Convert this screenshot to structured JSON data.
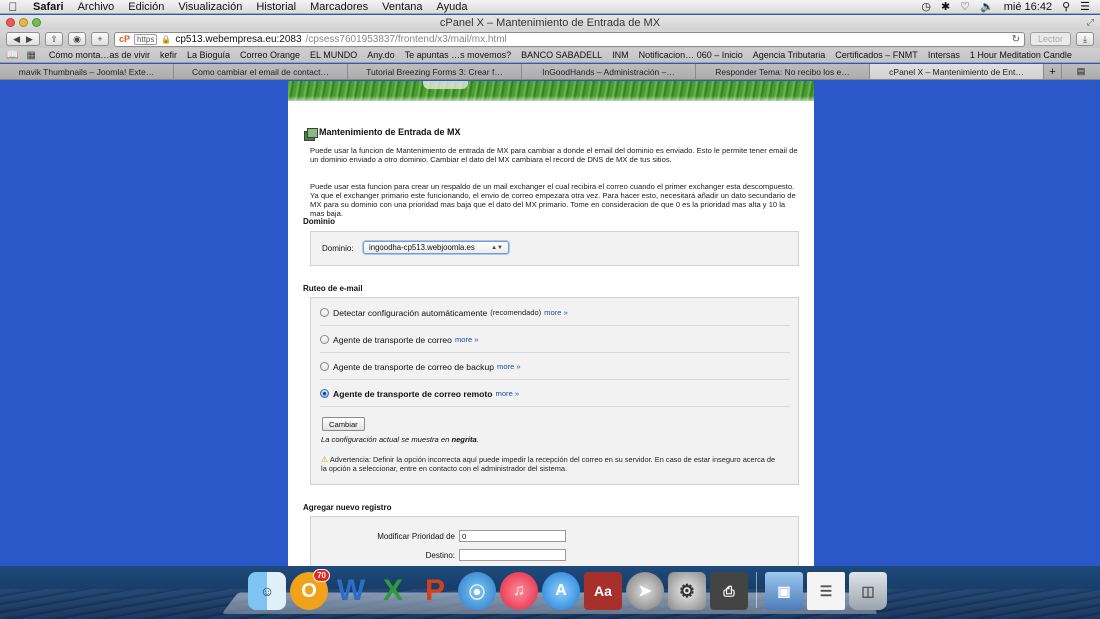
{
  "menubar": {
    "app": "Safari",
    "items": [
      "Archivo",
      "Edición",
      "Visualización",
      "Historial",
      "Marcadores",
      "Ventana",
      "Ayuda"
    ],
    "clock": "mié 16:42"
  },
  "window": {
    "title": "cPanel X – Mantenimiento de Entrada de MX"
  },
  "toolbar": {
    "url_scheme": "https",
    "url_host": "cp513.webempresa.eu:2083",
    "url_path": "/cpsess7601953837/frontend/x3/mail/mx.html",
    "reader_label": "Lector"
  },
  "bookmarks": [
    "Cómo monta…as de vivir",
    "kefir",
    "La Bioguía",
    "Correo Orange",
    "EL MUNDO",
    "Any.do",
    "Te apuntas …s movemos?",
    "BANCO SABADELL",
    "INM",
    "Notificacion… 060 – Inicio",
    "Agencia Tributaria",
    "Certificados – FNMT",
    "Intersas",
    "1 Hour Meditation Candle"
  ],
  "tabs": [
    {
      "label": "mavik Thumbnails – Joomla! Exte…",
      "active": false
    },
    {
      "label": "Como cambiar el email de contact…",
      "active": false
    },
    {
      "label": "Tutorial Breezing Forms 3: Crear f…",
      "active": false
    },
    {
      "label": "InGoodHands – Administración –…",
      "active": false
    },
    {
      "label": "Responder Tema: No recibo los e…",
      "active": false
    },
    {
      "label": "cPanel X – Mantenimiento de Ent…",
      "active": true
    }
  ],
  "page": {
    "title": "Mantenimiento de Entrada de MX",
    "intro_1": "Puede usar la funcion de Mantenimiento de entrada de MX para cambiar a donde el email del dominio es enviado. Esto le permite tener email de un dominio enviado a otro dominio. Cambiar el dato del MX cambiara el record de DNS de MX de tus sitios.",
    "intro_2": "Puede usar esta funcion para crear un respaldo de un mail exchanger el cual recibira el correo cuando el primer exchanger esta descompuesto. Ya que el exchanger primario este funcionando, el envio de correo empezara otra vez. Para hacer esto, necesitará añadir un dato secundario de MX para su dominio con una prioridad mas baja que el dato del MX primario. Tome en consideracion de que 0 es la prioridad mas alta y 10 la mas baja.",
    "domain_heading": "Dominio",
    "domain_label": "Dominio:",
    "domain_value": "ingoodha-cp513.webjoomla.es",
    "routing_heading": "Ruteo de e-mail",
    "options": [
      {
        "label": "Detectar configuración automáticamente",
        "note": "(recomendado)",
        "more": "more »",
        "checked": false
      },
      {
        "label": "Agente de transporte de correo",
        "note": "",
        "more": "more »",
        "checked": false
      },
      {
        "label": "Agente de transporte de correo de backup",
        "note": "",
        "more": "more »",
        "checked": false
      },
      {
        "label": "Agente de transporte de correo remoto",
        "note": "",
        "more": "more »",
        "checked": true
      }
    ],
    "change_button": "Cambiar",
    "config_note_prefix": "La configuración actual se muestra en ",
    "config_note_bold": "negrita",
    "config_note_suffix": ".",
    "warning": "Advertencia: Definir la opción incorrecta aquí puede impedir la recepción del correo en su servidor. En caso de estar inseguro acerca de la opción a seleccionar, entre en contacto con el administrador del sistema.",
    "new_record_heading": "Agregar nuevo registro",
    "priority_label": "Modificar Prioridad de",
    "priority_value": "0",
    "destination_label": "Destino:",
    "destination_value": ""
  },
  "dock": {
    "outlook_badge": "70"
  }
}
